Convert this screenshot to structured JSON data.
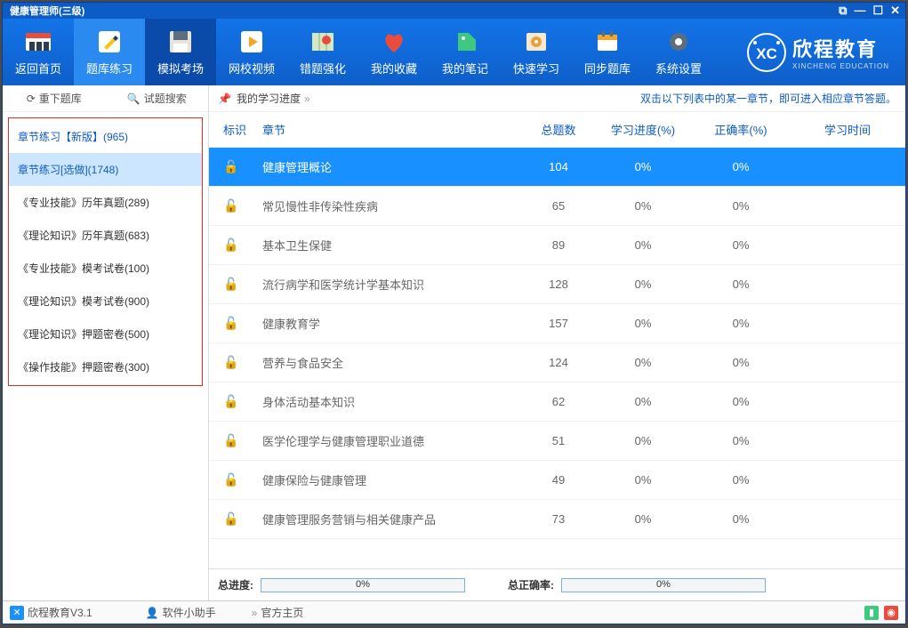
{
  "window_title": "健康管理师(三级)",
  "toolbar": {
    "items": [
      {
        "label": "返回首页"
      },
      {
        "label": "题库练习"
      },
      {
        "label": "模拟考场"
      },
      {
        "label": "网校视频"
      },
      {
        "label": "错题强化"
      },
      {
        "label": "我的收藏"
      },
      {
        "label": "我的笔记"
      },
      {
        "label": "快速学习"
      },
      {
        "label": "同步题库"
      },
      {
        "label": "系统设置"
      }
    ],
    "brand": {
      "name": "欣程教育",
      "sub": "XINCHENG EDUCATION",
      "badge": "XC"
    }
  },
  "sidebar": {
    "refresh": "重下题库",
    "search": "试题搜索",
    "items": [
      "章节练习【新版】(965)",
      "章节练习[选做](1748)",
      "《专业技能》历年真题(289)",
      "《理论知识》历年真题(683)",
      "《专业技能》模考试卷(100)",
      "《理论知识》模考试卷(900)",
      "《理论知识》押题密卷(500)",
      "《操作技能》押题密卷(300)"
    ]
  },
  "content": {
    "progress_label": "我的学习进度",
    "hint": "双击以下列表中的某一章节，即可进入相应章节答题。",
    "columns": {
      "lock": "标识",
      "chapter": "章节",
      "total": "总题数",
      "progress": "学习进度(%)",
      "accuracy": "正确率(%)",
      "time": "学习时间"
    },
    "rows": [
      {
        "chapter": "健康管理概论",
        "total": "104",
        "progress": "0%",
        "accuracy": "0%"
      },
      {
        "chapter": "常见慢性非传染性疾病",
        "total": "65",
        "progress": "0%",
        "accuracy": "0%"
      },
      {
        "chapter": "基本卫生保健",
        "total": "89",
        "progress": "0%",
        "accuracy": "0%"
      },
      {
        "chapter": "流行病学和医学统计学基本知识",
        "total": "128",
        "progress": "0%",
        "accuracy": "0%"
      },
      {
        "chapter": "健康教育学",
        "total": "157",
        "progress": "0%",
        "accuracy": "0%"
      },
      {
        "chapter": "营养与食品安全",
        "total": "124",
        "progress": "0%",
        "accuracy": "0%"
      },
      {
        "chapter": "身体活动基本知识",
        "total": "62",
        "progress": "0%",
        "accuracy": "0%"
      },
      {
        "chapter": "医学伦理学与健康管理职业道德",
        "total": "51",
        "progress": "0%",
        "accuracy": "0%"
      },
      {
        "chapter": "健康保险与健康管理",
        "total": "49",
        "progress": "0%",
        "accuracy": "0%"
      },
      {
        "chapter": "健康管理服务营销与相关健康产品",
        "total": "73",
        "progress": "0%",
        "accuracy": "0%"
      }
    ],
    "summary": {
      "total_progress_label": "总进度:",
      "total_progress": "0%",
      "total_accuracy_label": "总正确率:",
      "total_accuracy": "0%"
    }
  },
  "statusbar": {
    "app": "欣程教育V3.1",
    "helper": "软件小助手",
    "home": "官方主页"
  }
}
